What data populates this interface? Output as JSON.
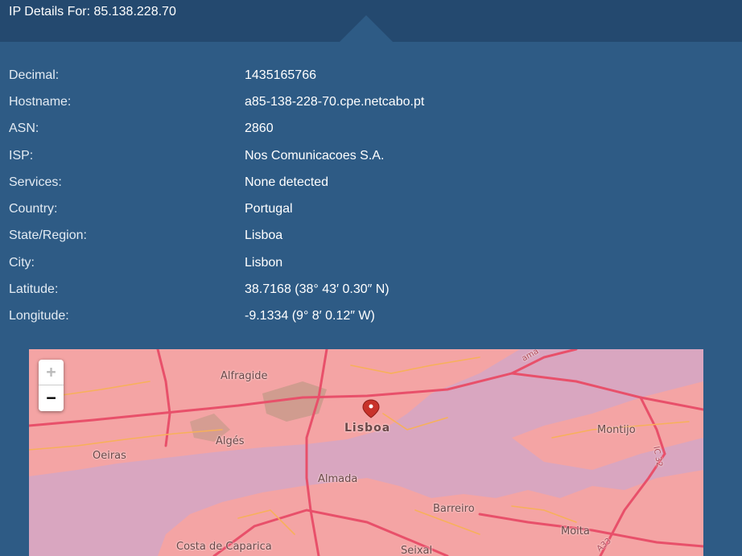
{
  "header": {
    "title": "IP Details For: 85.138.228.70"
  },
  "details": [
    {
      "label": "Decimal:",
      "value": "1435165766"
    },
    {
      "label": "Hostname:",
      "value": "a85-138-228-70.cpe.netcabo.pt"
    },
    {
      "label": "ASN:",
      "value": "2860"
    },
    {
      "label": "ISP:",
      "value": "Nos Comunicacoes S.A."
    },
    {
      "label": "Services:",
      "value": "None detected"
    },
    {
      "label": "Country:",
      "value": "Portugal"
    },
    {
      "label": "State/Region:",
      "value": "Lisboa"
    },
    {
      "label": "City:",
      "value": "Lisbon"
    },
    {
      "label": "Latitude:",
      "value": "38.7168 (38° 43′ 0.30″ N)"
    },
    {
      "label": "Longitude:",
      "value": "-9.1334 (9° 8′ 0.12″ W)"
    }
  ],
  "map": {
    "zoom_in": "+",
    "zoom_out": "−",
    "marker_icon": "map-pin-icon",
    "places": {
      "alfragide": "Alfragide",
      "lisboa": "Lisboa",
      "montijo": "Montijo",
      "alges": "Algés",
      "oeiras": "Oeiras",
      "almada": "Almada",
      "barreiro": "Barreiro",
      "moita": "Moita",
      "costa_de_caparica": "Costa de Caparica",
      "seixal": "Seixal"
    },
    "roads": {
      "ic32": "IC 32",
      "a33": "A33",
      "ama": "ama"
    }
  },
  "colors": {
    "header_bg": "#24496f",
    "panel_bg": "#2e5b85",
    "map_land": "#f4a4a4",
    "map_water": "#d9a6c0",
    "map_road": "#e8506a",
    "marker": "#c8322a"
  }
}
